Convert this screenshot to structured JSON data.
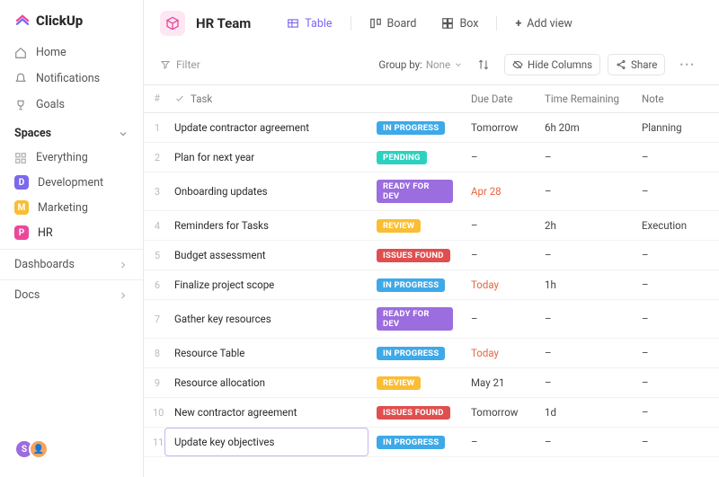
{
  "brand": "ClickUp",
  "nav": {
    "home": "Home",
    "notifications": "Notifications",
    "goals": "Goals"
  },
  "spaces": {
    "header": "Spaces",
    "everything": "Everything",
    "items": [
      {
        "initial": "D",
        "label": "Development"
      },
      {
        "initial": "M",
        "label": "Marketing"
      },
      {
        "initial": "P",
        "label": "HR"
      }
    ]
  },
  "bottom": {
    "dashboards": "Dashboards",
    "docs": "Docs"
  },
  "workspace": {
    "title": "HR Team"
  },
  "views": {
    "table": "Table",
    "board": "Board",
    "box": "Box",
    "add": "Add view"
  },
  "toolbar": {
    "filter": "Filter",
    "group_by_label": "Group by:",
    "group_by_value": "None",
    "hide_columns": "Hide Columns",
    "share": "Share"
  },
  "columns": {
    "idx": "#",
    "task": "Task",
    "due": "Due Date",
    "time": "Time Remaining",
    "note": "Note"
  },
  "rows": [
    {
      "n": "1",
      "task": "Update contractor agreement",
      "status": "IN PROGRESS",
      "status_class": "b-inprogress",
      "due": "Tomorrow",
      "due_class": "",
      "time": "6h 20m",
      "note": "Planning"
    },
    {
      "n": "2",
      "task": "Plan for next year",
      "status": "PENDING",
      "status_class": "b-pending",
      "due": "–",
      "due_class": "",
      "time": "–",
      "note": "–"
    },
    {
      "n": "3",
      "task": "Onboarding updates",
      "status": "READY FOR DEV",
      "status_class": "b-ready",
      "due": "Apr 28",
      "due_class": "due-red",
      "time": "–",
      "note": "–"
    },
    {
      "n": "4",
      "task": "Reminders for Tasks",
      "status": "REVIEW",
      "status_class": "b-review",
      "due": "–",
      "due_class": "",
      "time": "2h",
      "note": "Execution"
    },
    {
      "n": "5",
      "task": "Budget assessment",
      "status": "ISSUES FOUND",
      "status_class": "b-issues",
      "due": "–",
      "due_class": "",
      "time": "–",
      "note": "–"
    },
    {
      "n": "6",
      "task": "Finalize project scope",
      "status": "IN PROGRESS",
      "status_class": "b-inprogress",
      "due": "Today",
      "due_class": "due-red",
      "time": "1h",
      "note": "–"
    },
    {
      "n": "7",
      "task": "Gather key resources",
      "status": "READY FOR DEV",
      "status_class": "b-ready",
      "due": "–",
      "due_class": "",
      "time": "–",
      "note": "–"
    },
    {
      "n": "8",
      "task": "Resource Table",
      "status": "IN PROGRESS",
      "status_class": "b-inprogress",
      "due": "Today",
      "due_class": "due-red",
      "time": "–",
      "note": "–"
    },
    {
      "n": "9",
      "task": "Resource allocation",
      "status": "REVIEW",
      "status_class": "b-review",
      "due": "May 21",
      "due_class": "",
      "time": "–",
      "note": "–"
    },
    {
      "n": "10",
      "task": "New contractor agreement",
      "status": "ISSUES FOUND",
      "status_class": "b-issues",
      "due": "Tomorrow",
      "due_class": "",
      "time": "1d",
      "note": "–"
    },
    {
      "n": "11",
      "task": "Update key objectives",
      "status": "IN PROGRESS",
      "status_class": "b-inprogress",
      "due": "–",
      "due_class": "",
      "time": "–",
      "note": "–",
      "editing": true
    }
  ]
}
